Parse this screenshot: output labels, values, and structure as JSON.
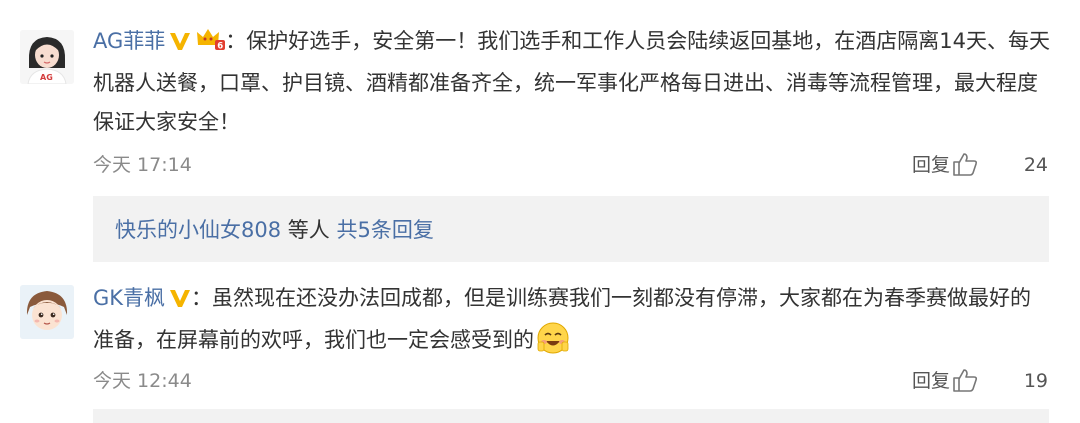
{
  "comments": [
    {
      "username": "AG菲菲",
      "separator": "：",
      "text": "保护好选手，安全第一！我们选手和工作人员会陆续返回基地，在酒店隔离14天、每天机器人送餐，口罩、护目镜、酒精都准备齐全，统一军事化严格每日进出、消毒等流程管理，最大程度保证大家安全！",
      "time": "今天 17:14",
      "reply_label": "回复",
      "likes": "24",
      "badges": [
        "verified-v-icon",
        "membership-crown-icon"
      ],
      "sub_replies": {
        "user": "快乐的小仙女808",
        "middle": " 等人 ",
        "link": "共5条回复"
      }
    },
    {
      "username": "GK青枫",
      "separator": "：",
      "text": "虽然现在还没办法回成都，但是训练赛我们一刻都没有停滞，大家都在为春季赛做最好的准备，在屏幕前的欢呼，我们也一定会感受到的",
      "emoji": "blushing-smile-emoji",
      "time": "今天 12:44",
      "reply_label": "回复",
      "likes": "19",
      "badges": [
        "verified-v-icon"
      ]
    }
  ],
  "colors": {
    "username": "#4a6fa5",
    "badge_gold": "#f5b400",
    "meta": "#8a8a8a",
    "sub_reply_bg": "#f2f2f2"
  }
}
